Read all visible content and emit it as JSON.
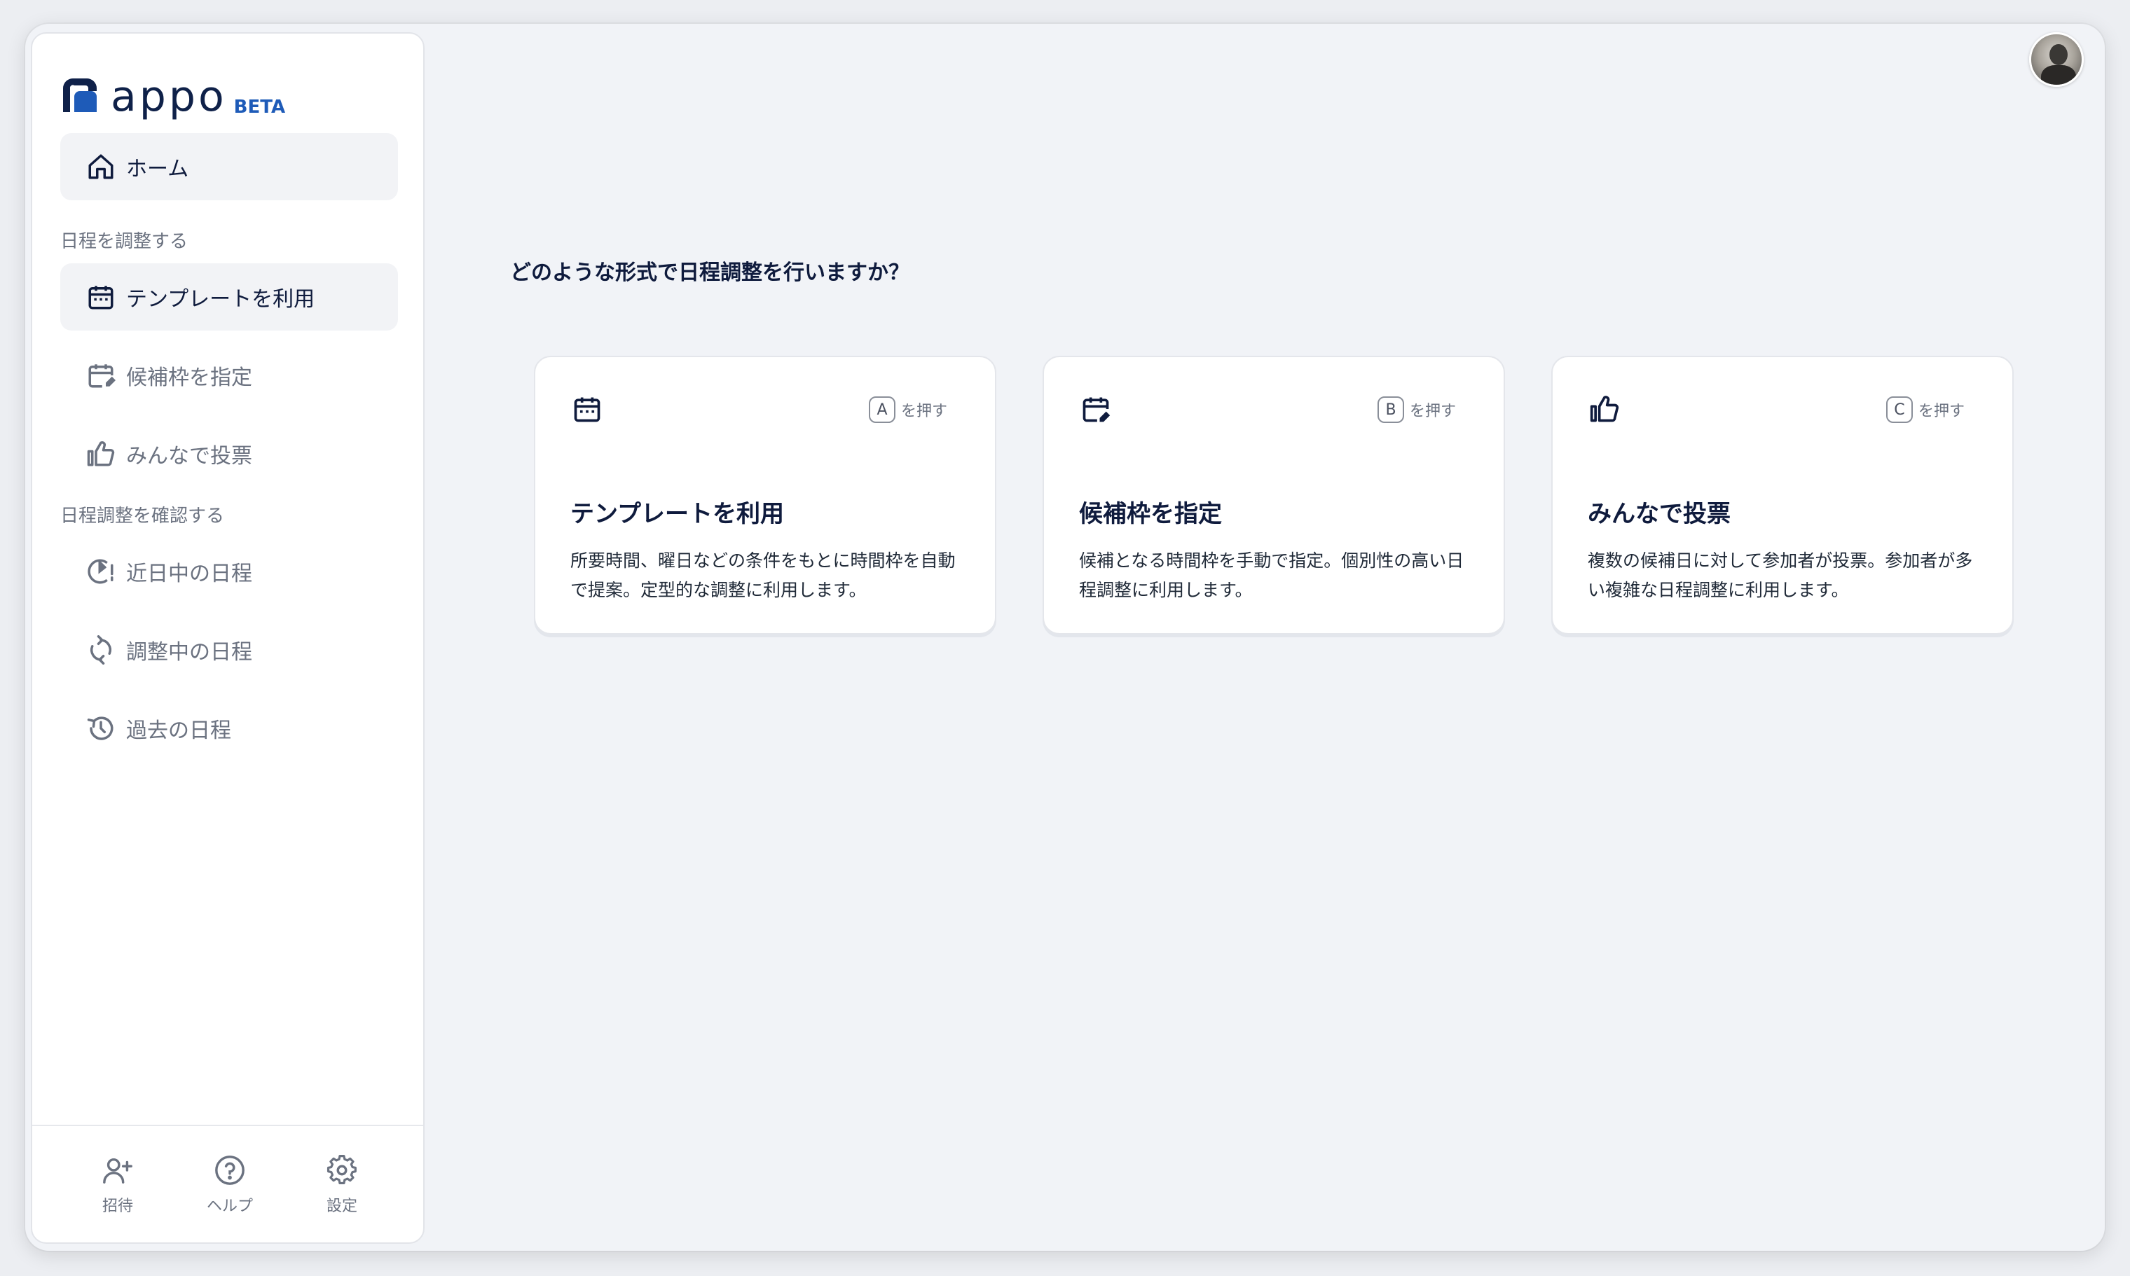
{
  "app": {
    "logo_text": "appo",
    "beta_label": "BETA"
  },
  "sidebar": {
    "home_label": "ホーム",
    "section_schedule": "日程を調整する",
    "items_schedule": [
      {
        "label": "テンプレートを利用",
        "icon": "calendar-icon"
      },
      {
        "label": "候補枠を指定",
        "icon": "calendar-edit-icon"
      },
      {
        "label": "みんなで投票",
        "icon": "thumbs-up-icon"
      }
    ],
    "section_confirm": "日程調整を確認する",
    "items_confirm": [
      {
        "label": "近日中の日程",
        "icon": "clock-alert-icon"
      },
      {
        "label": "調整中の日程",
        "icon": "sync-icon"
      },
      {
        "label": "過去の日程",
        "icon": "history-icon"
      }
    ],
    "footer": [
      {
        "label": "招待",
        "icon": "add-user-icon"
      },
      {
        "label": "ヘルプ",
        "icon": "help-icon"
      },
      {
        "label": "設定",
        "icon": "gear-icon"
      }
    ]
  },
  "main": {
    "question": "どのような形式で日程調整を行いますか？",
    "cards": [
      {
        "key": "A",
        "shortcut_suffix": "を押す",
        "title": "テンプレートを利用",
        "desc": "所要時間、曜日などの条件をもとに時間枠を自動で提案。定型的な調整に利用します。"
      },
      {
        "key": "B",
        "shortcut_suffix": "を押す",
        "title": "候補枠を指定",
        "desc": "候補となる時間枠を手動で指定。個別性の高い日程調整に利用します。"
      },
      {
        "key": "C",
        "shortcut_suffix": "を押す",
        "title": "みんなで投票",
        "desc": "複数の候補日に対して参加者が投票。参加者が多い複雑な日程調整に利用します。"
      }
    ]
  },
  "colors": {
    "navy": "#0f1b3d",
    "brand_blue": "#1e5bb8",
    "muted": "#6b7280"
  }
}
